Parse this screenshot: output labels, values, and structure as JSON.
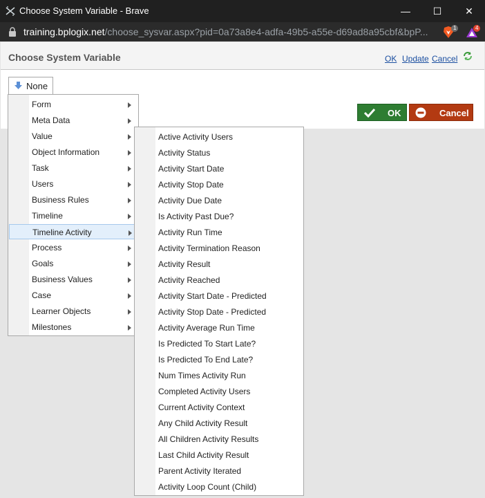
{
  "window": {
    "title": "Choose System Variable - Brave",
    "minimize_glyph": "—",
    "maximize_glyph": "☐",
    "close_glyph": "✕"
  },
  "address": {
    "host": "training.bplogix.net",
    "path": "/choose_sysvar.aspx?pid=0a73a8e4-adfa-49b5-a55e-d69ad8a95cbf&bpP...",
    "shields_badge": "1",
    "rewards_badge": "4"
  },
  "dialog": {
    "title": "Choose System Variable",
    "links": {
      "ok": "OK",
      "update": "Update",
      "cancel": "Cancel"
    },
    "none_label": "None",
    "ok_label": "OK",
    "cancel_label": "Cancel"
  },
  "menu": {
    "items": [
      "Form",
      "Meta Data",
      "Value",
      "Object Information",
      "Task",
      "Users",
      "Business Rules",
      "Timeline",
      "Timeline Activity",
      "Process",
      "Goals",
      "Business Values",
      "Case",
      "Learner Objects",
      "Milestones"
    ],
    "active_index": 8
  },
  "submenu": {
    "items": [
      "Active Activity Users",
      "Activity Status",
      "Activity Start Date",
      "Activity Stop Date",
      "Activity Due Date",
      "Is Activity Past Due?",
      "Activity Run Time",
      "Activity Termination Reason",
      "Activity Result",
      "Activity Reached",
      "Activity Start Date - Predicted",
      "Activity Stop Date - Predicted",
      "Activity Average Run Time",
      "Is Predicted To Start Late?",
      "Is Predicted To End Late?",
      "Num Times Activity Run",
      "Completed Activity Users",
      "Current Activity Context",
      "Any Child Activity Result",
      "All Children Activity Results",
      "Last Child Activity Result",
      "Parent Activity Iterated",
      "Activity Loop Count (Child)"
    ]
  },
  "colors": {
    "ok_green": "#2e7d32",
    "cancel_red": "#b33a12",
    "link_blue": "#1a4ea0",
    "active_item": "#e3effb"
  }
}
